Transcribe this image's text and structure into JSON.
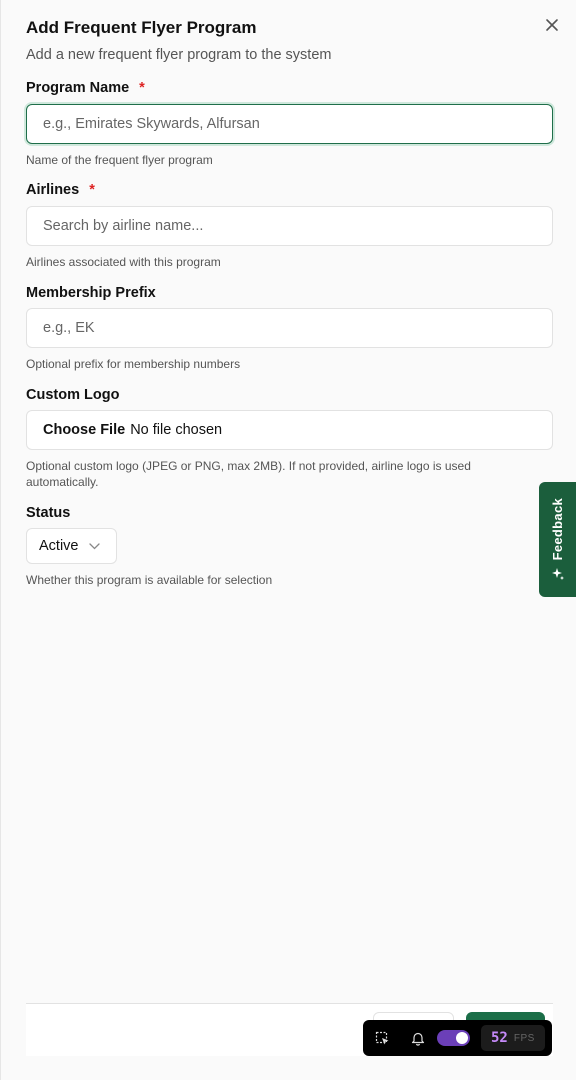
{
  "dialog": {
    "title": "Add Frequent Flyer Program",
    "subtitle": "Add a new frequent flyer program to the system"
  },
  "fields": {
    "program_name": {
      "label": "Program Name",
      "required_mark": "*",
      "placeholder": "e.g., Emirates Skywards, Alfursan",
      "value": "",
      "help": "Name of the frequent flyer program"
    },
    "airlines": {
      "label": "Airlines",
      "required_mark": "*",
      "placeholder": "Search by airline name...",
      "value": "",
      "help": "Airlines associated with this program"
    },
    "membership_prefix": {
      "label": "Membership Prefix",
      "placeholder": "e.g., EK",
      "value": "",
      "help": "Optional prefix for membership numbers"
    },
    "custom_logo": {
      "label": "Custom Logo",
      "button_label": "Choose File",
      "file_status": "No file chosen",
      "help": "Optional custom logo (JPEG or PNG, max 2MB). If not provided, airline logo is used automatically."
    },
    "status": {
      "label": "Status",
      "selected": "Active",
      "help": "Whether this program is available for selection"
    }
  },
  "feedback_tab": {
    "label": "Feedback",
    "icon": "sparkle-icon"
  },
  "devtools": {
    "fps_value": "52",
    "fps_label": "FPS",
    "toggle_on": true
  },
  "colors": {
    "focus_border": "#1f6e4a",
    "required": "#dd2222",
    "feedback_bg": "#1b5e3c",
    "save_button": "#1b6e48",
    "toggle": "#6b3fb8",
    "fps_text": "#c58af9"
  }
}
